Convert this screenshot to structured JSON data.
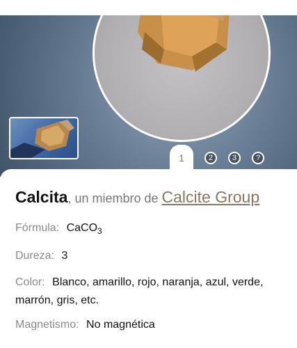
{
  "mineral": {
    "name": "Calcita",
    "member_text": ", un miembro de ",
    "group_link": "Calcite Group"
  },
  "gallery": {
    "pages": [
      "1",
      "2",
      "3",
      "?"
    ],
    "active_page": "1"
  },
  "properties": {
    "formula": {
      "label": "Fórmula:",
      "value_main": "CaCO",
      "value_sub": "3"
    },
    "hardness": {
      "label": "Dureza:",
      "value": "3"
    },
    "color": {
      "label": "Color:",
      "value": "Blanco, amarillo, rojo, naranja, azul, verde, marrón, gris, etc."
    },
    "magnetism": {
      "label": "Magnetismo:",
      "value": "No magnética"
    }
  },
  "colors": {
    "accent": "#8a7560",
    "label": "#8a8a8a",
    "hero_bg": "#6a7f96"
  }
}
